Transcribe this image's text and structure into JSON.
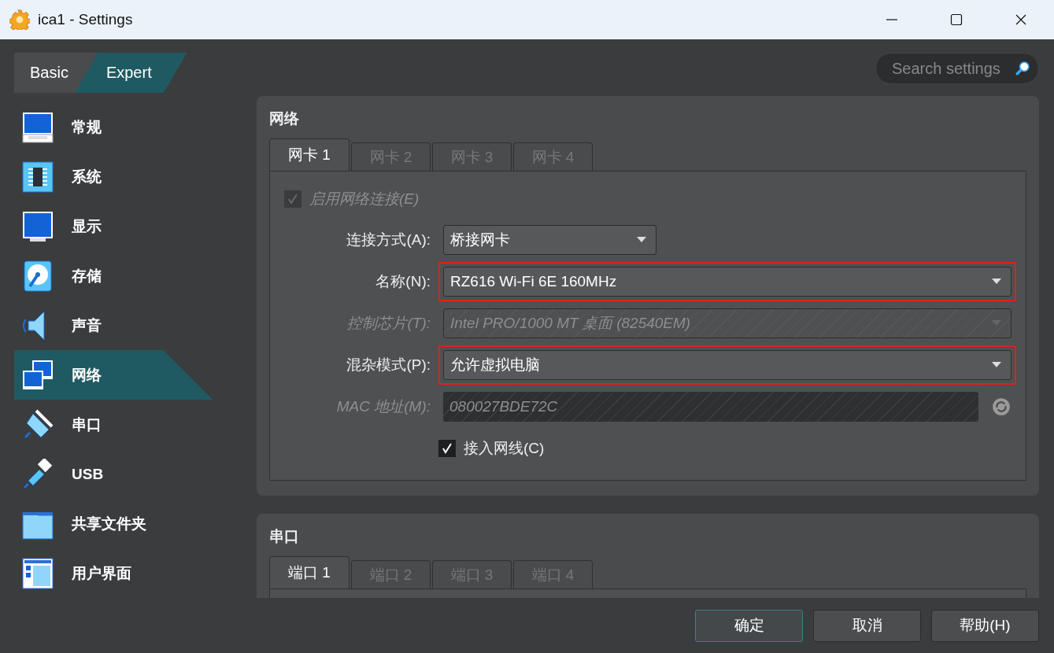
{
  "window": {
    "title": "ica1 - Settings"
  },
  "mode_tabs": [
    {
      "label": "Basic",
      "selected": false
    },
    {
      "label": "Expert",
      "selected": true
    }
  ],
  "search": {
    "placeholder": "Search settings"
  },
  "sidebar": {
    "items": [
      {
        "label": "常规",
        "selected": false
      },
      {
        "label": "系统",
        "selected": false
      },
      {
        "label": "显示",
        "selected": false
      },
      {
        "label": "存储",
        "selected": false
      },
      {
        "label": "声音",
        "selected": false
      },
      {
        "label": "网络",
        "selected": true
      },
      {
        "label": "串口",
        "selected": false
      },
      {
        "label": "USB",
        "selected": false
      },
      {
        "label": "共享文件夹",
        "selected": false
      },
      {
        "label": "用户界面",
        "selected": false
      }
    ]
  },
  "network": {
    "title": "网络",
    "tabs": [
      {
        "label": "网卡 1",
        "selected": true
      },
      {
        "label": "网卡 2",
        "selected": false
      },
      {
        "label": "网卡 3",
        "selected": false
      },
      {
        "label": "网卡 4",
        "selected": false
      }
    ],
    "enable": {
      "label": "启用网络连接(E)",
      "checked": true,
      "disabled": true
    },
    "rows": [
      {
        "kind": "combo",
        "label": "连接方式(A):",
        "value": "桥接网卡",
        "disabled": false,
        "highlighted": false
      },
      {
        "kind": "combo",
        "label": "名称(N):",
        "value": "RZ616 Wi-Fi 6E 160MHz",
        "disabled": false,
        "highlighted": true
      },
      {
        "kind": "combo",
        "label": "控制芯片(T):",
        "value": "Intel PRO/1000 MT 桌面 (82540EM)",
        "disabled": true,
        "highlighted": false
      },
      {
        "kind": "combo",
        "label": "混杂模式(P):",
        "value": "允许虚拟电脑",
        "disabled": false,
        "highlighted": true
      },
      {
        "kind": "field",
        "label": "MAC 地址(M):",
        "value": "080027BDE72C",
        "disabled": true,
        "highlighted": false
      },
      {
        "kind": "checkbox",
        "label": "接入网线(C)",
        "checked": true,
        "disabled": false
      }
    ]
  },
  "serial": {
    "title": "串口",
    "tabs": [
      {
        "label": "端口 1",
        "selected": true
      },
      {
        "label": "端口 2",
        "selected": false
      },
      {
        "label": "端口 3",
        "selected": false
      },
      {
        "label": "端口 4",
        "selected": false
      }
    ]
  },
  "buttons": [
    {
      "label": "确定",
      "default": true
    },
    {
      "label": "取消",
      "default": false
    },
    {
      "label": "帮助(H)",
      "default": false
    }
  ]
}
